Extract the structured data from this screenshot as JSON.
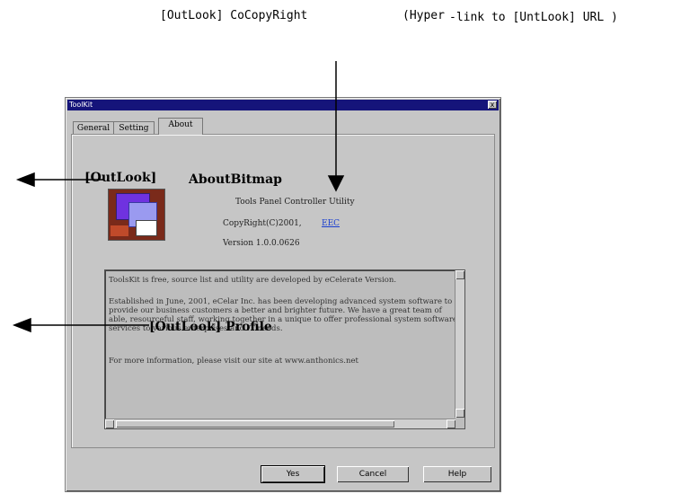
{
  "annotations": {
    "copyright_note": "[OutLook] CoCopyRight",
    "hyperlink_note_a": "(Hyper",
    "hyperlink_note_b": "-link to [UntLook] URL )",
    "bitmap_note": "[OutLook]",
    "bitmap_note_2": "AboutBitmap",
    "profile_note": "[OutLook] Profile"
  },
  "dialog": {
    "title": "ToolKit",
    "close": "x",
    "tabs": [
      "General",
      "Setting",
      "About"
    ],
    "active_tab": "About",
    "product_name": "Tools Panel Controller Utility",
    "copyright": "CopyRight(C)2001,",
    "link_text": "EEC",
    "version": "Version 1.0.0.0626",
    "profile_paragraphs": [
      "ToolsKit is free, source list and utility are developed by eCelerate Version.",
      "Established in June, 2001, eCelar Inc. has been developing advanced system software to provide our business customers a better and brighter future. We have a great team of able, resourceful staff, working together in a unique to offer professional system software services to various enterprises and IT needs.",
      "For more information, please visit our site at www.anthonics.net"
    ],
    "buttons": {
      "ok": "Yes",
      "cancel": "Cancel",
      "help": "Help"
    }
  }
}
